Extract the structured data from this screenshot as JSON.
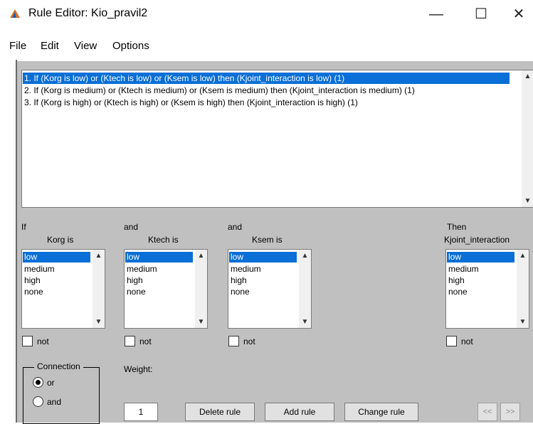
{
  "window": {
    "title": "Rule Editor: Kio_pravil2",
    "minimize": "—",
    "maximize": "☐",
    "close": "✕"
  },
  "menu": [
    "File",
    "Edit",
    "View",
    "Options"
  ],
  "rules": [
    "1. If (Korg is low) or (Ktech is low) or (Ksem is low) then (Kjoint_interaction is low) (1)",
    "2. If (Korg is medium) or (Ktech is medium) or (Ksem is medium) then (Kjoint_interaction is medium) (1)",
    "3. If (Korg is high) or (Ktech is high) or (Ksem is high) then (Kjoint_interaction is high) (1)"
  ],
  "selected_rule_index": 0,
  "inputs": [
    {
      "connector": "If",
      "name": "Korg is",
      "options": [
        "low",
        "medium",
        "high",
        "none"
      ],
      "selected": "low",
      "not_label": "not"
    },
    {
      "connector": "and",
      "name": "Ktech is",
      "options": [
        "low",
        "medium",
        "high",
        "none"
      ],
      "selected": "low",
      "not_label": "not"
    },
    {
      "connector": "and",
      "name": "Ksem is",
      "options": [
        "low",
        "medium",
        "high",
        "none"
      ],
      "selected": "low",
      "not_label": "not"
    }
  ],
  "output": {
    "connector": "Then",
    "name": "Kjoint_interaction",
    "options": [
      "low",
      "medium",
      "high",
      "none"
    ],
    "selected": "low",
    "not_label": "not"
  },
  "connection": {
    "title": "Connection",
    "options": [
      "or",
      "and"
    ],
    "selected": "or"
  },
  "weight": {
    "label": "Weight:",
    "value": "1"
  },
  "buttons": {
    "delete": "Delete rule",
    "add": "Add rule",
    "change": "Change rule",
    "prev": "<<",
    "next": ">>"
  },
  "colors": {
    "selection": "#0a6fd6",
    "panel": "#c0c0c0"
  }
}
